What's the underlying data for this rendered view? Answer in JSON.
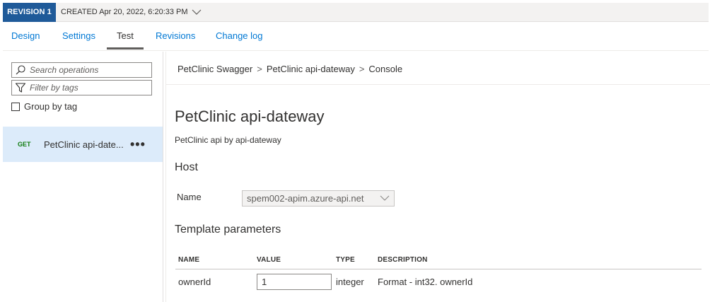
{
  "revision": {
    "badge": "REVISION 1",
    "created": "CREATED Apr 20, 2022, 6:20:33 PM",
    "chevron_icon": "chevron-down-icon"
  },
  "tabs": [
    {
      "label": "Design",
      "active": false
    },
    {
      "label": "Settings",
      "active": false
    },
    {
      "label": "Test",
      "active": true
    },
    {
      "label": "Revisions",
      "active": false
    },
    {
      "label": "Change log",
      "active": false
    }
  ],
  "sidebar": {
    "search_placeholder": "Search operations",
    "filter_placeholder": "Filter by tags",
    "group_by_label": "Group by tag",
    "group_by_checked": false,
    "operations": [
      {
        "method": "GET",
        "name": "PetClinic api-date...",
        "more": "•••",
        "selected": true
      }
    ]
  },
  "main": {
    "breadcrumb": [
      "PetClinic Swagger",
      "PetClinic api-dateway",
      "Console"
    ],
    "breadcrumb_separator": ">",
    "title": "PetClinic api-dateway",
    "subtitle": "PetClinic api by api-dateway",
    "host_heading": "Host",
    "host_name_label": "Name",
    "host_name_value": "spem002-apim.azure-api.net",
    "template_heading": "Template parameters",
    "table": {
      "headers": [
        "NAME",
        "VALUE",
        "TYPE",
        "DESCRIPTION"
      ],
      "rows": [
        {
          "name": "ownerId",
          "value": "1",
          "type": "integer",
          "description": "Format - int32. ownerId"
        }
      ]
    }
  },
  "colors": {
    "accent": "#0078d4",
    "badge_bg": "#1f5a99",
    "selected_row": "#dcebfa",
    "get_method": "#107c10"
  }
}
